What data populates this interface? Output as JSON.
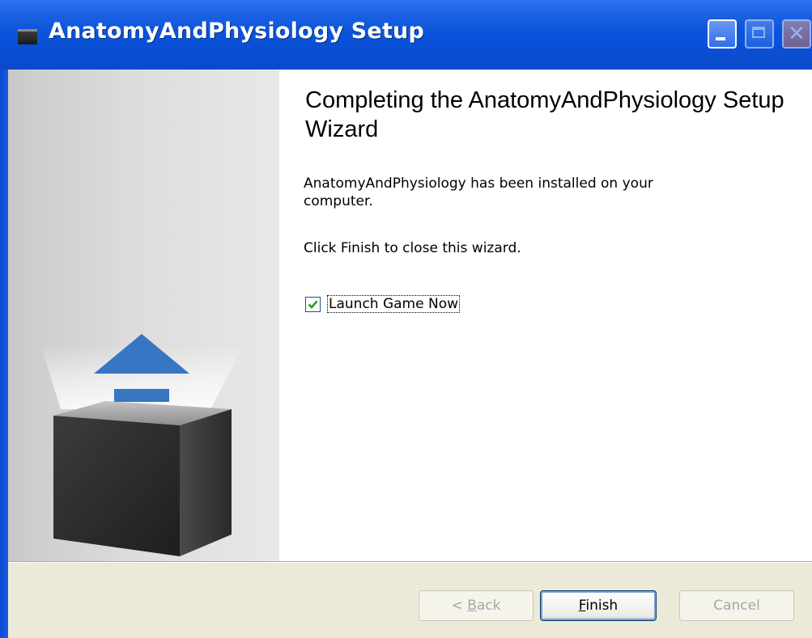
{
  "window": {
    "title": "AnatomyAndPhysiology Setup",
    "title_icon": "installer-box-icon",
    "buttons": {
      "minimize": "minimize-icon",
      "maximize": "maximize-icon",
      "close_glyph": "✕"
    }
  },
  "content": {
    "heading": "Completing the AnatomyAndPhysiology Setup Wizard",
    "installed_text": "AnatomyAndPhysiology has been installed on your computer.",
    "finish_hint": "Click Finish to close this wizard.",
    "launch_checkbox": {
      "label": "Launch Game Now",
      "checked": true
    }
  },
  "footer": {
    "back_prefix": "< ",
    "back_key": "B",
    "back_rest": "ack",
    "finish_key": "F",
    "finish_rest": "inish",
    "cancel_label": "Cancel"
  },
  "colors": {
    "titlebar": "#0a55dc",
    "dialog": "#ece9d8",
    "arrow": "#3676c2",
    "box": "#2e2e2e",
    "checkmark": "#21a121"
  }
}
